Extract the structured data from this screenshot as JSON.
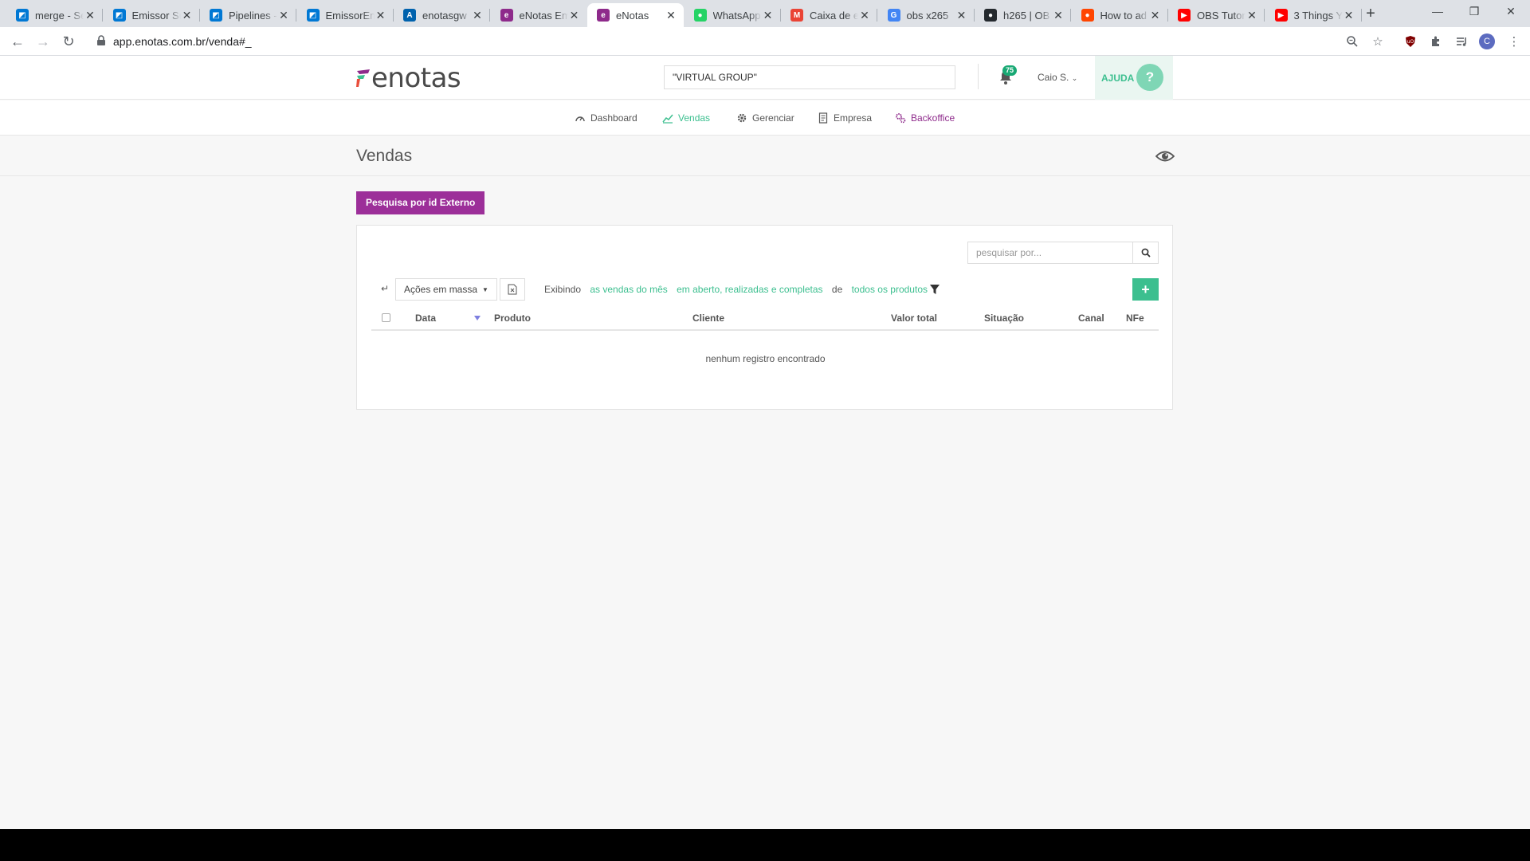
{
  "browser": {
    "tabs": [
      {
        "title": "merge - Se",
        "icon": "azure-devops-icon",
        "color": "#0078d4"
      },
      {
        "title": "Emissor Su",
        "icon": "azure-devops-icon",
        "color": "#0078d4"
      },
      {
        "title": "Pipelines -",
        "icon": "azure-devops-icon",
        "color": "#0078d4"
      },
      {
        "title": "EmissorEm",
        "icon": "azure-devops-icon",
        "color": "#0078d4"
      },
      {
        "title": "enotasgw",
        "icon": "azure-icon",
        "color": "#0062ad"
      },
      {
        "title": "eNotas Em",
        "icon": "enotas-icon",
        "color": "#8e2a8b"
      },
      {
        "title": "eNotas",
        "icon": "enotas-icon",
        "color": "#8e2a8b"
      },
      {
        "title": "WhatsApp",
        "icon": "whatsapp-icon",
        "color": "#25d366"
      },
      {
        "title": "Caixa de e",
        "icon": "gmail-icon",
        "color": "#ea4335"
      },
      {
        "title": "obs x265",
        "icon": "google-icon",
        "color": "#4285f4"
      },
      {
        "title": "h265 | OB",
        "icon": "github-icon",
        "color": "#24292e"
      },
      {
        "title": "How to ad",
        "icon": "reddit-icon",
        "color": "#ff4500"
      },
      {
        "title": "OBS Tutor",
        "icon": "youtube-icon",
        "color": "#ff0000"
      },
      {
        "title": "3 Things Y",
        "icon": "youtube-icon",
        "color": "#ff0000"
      }
    ],
    "active_tab": 6,
    "url": "app.enotas.com.br/venda#_"
  },
  "header": {
    "logo_text": "enotas",
    "search_value": "\"VIRTUAL GROUP\"",
    "notifications_count": "75",
    "user_name": "Caio S.",
    "help_label": "AJUDA",
    "help_symbol": "?"
  },
  "nav": {
    "items": [
      {
        "label": "Dashboard",
        "icon": "dashboard-icon"
      },
      {
        "label": "Vendas",
        "icon": "chart-line-icon"
      },
      {
        "label": "Gerenciar",
        "icon": "gear-icon"
      },
      {
        "label": "Empresa",
        "icon": "document-icon"
      },
      {
        "label": "Backoffice",
        "icon": "gears-icon"
      }
    ],
    "active": "Vendas"
  },
  "page": {
    "title": "Vendas",
    "external_search_button": "Pesquisa por id Externo"
  },
  "panel": {
    "search_placeholder": "pesquisar por...",
    "mass_actions_label": "Ações em massa",
    "filter": {
      "prefix": "Exibindo",
      "period": "as vendas do mês",
      "status": "em aberto, realizadas e completas",
      "connector": "de",
      "products": "todos os produtos"
    },
    "add_symbol": "+",
    "columns": [
      "Data",
      "Produto",
      "Cliente",
      "Valor total",
      "Situação",
      "Canal",
      "NFe"
    ],
    "empty_message": "nenhum registro encontrado"
  },
  "colors": {
    "brand_purple": "#9c2f99",
    "brand_green": "#3cbf8f",
    "badge_green": "#19a974"
  }
}
